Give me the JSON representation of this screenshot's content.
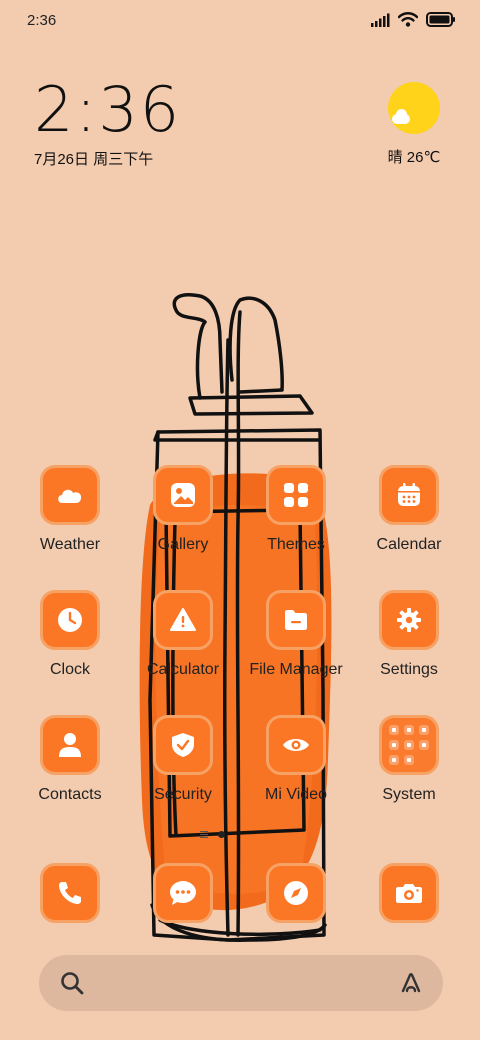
{
  "status_bar": {
    "time": "2:36",
    "icons": [
      "signal-icon",
      "wifi-icon",
      "battery-icon"
    ]
  },
  "clock_widget": {
    "time": "2:36",
    "date": "7月26日 周三下午"
  },
  "weather_widget": {
    "icon": "sunny-icon",
    "text": "晴 26℃"
  },
  "apps": [
    {
      "label": "Weather",
      "icon": "weather-icon"
    },
    {
      "label": "Gallery",
      "icon": "gallery-icon"
    },
    {
      "label": "Themes",
      "icon": "themes-icon"
    },
    {
      "label": "Calendar",
      "icon": "calendar-icon"
    },
    {
      "label": "Clock",
      "icon": "clock-icon"
    },
    {
      "label": "Calculator",
      "icon": "calculator-icon"
    },
    {
      "label": "File Manager",
      "icon": "folder-icon"
    },
    {
      "label": "Settings",
      "icon": "gear-icon"
    },
    {
      "label": "Contacts",
      "icon": "person-icon"
    },
    {
      "label": "Security",
      "icon": "shield-icon"
    },
    {
      "label": "Mi Video",
      "icon": "eye-icon"
    },
    {
      "label": "System",
      "icon": "folder-grid-icon"
    }
  ],
  "dock": [
    {
      "icon": "phone-icon"
    },
    {
      "icon": "message-icon"
    },
    {
      "icon": "compass-icon"
    },
    {
      "icon": "camera-icon"
    }
  ],
  "search_bar": {
    "icons": [
      "search-icon",
      "assistant-icon"
    ]
  },
  "colors": {
    "background": "#f3ccb0",
    "icon_tile": "#fb7726",
    "icon_border": "#f7a265",
    "search_bar": "#deb89e",
    "sun": "#ffd31a"
  }
}
